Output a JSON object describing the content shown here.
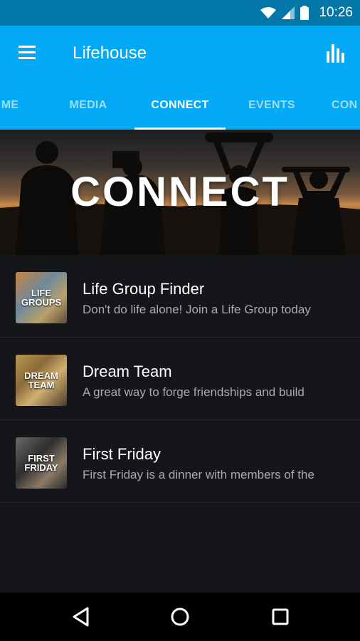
{
  "status_bar": {
    "time": "10:26",
    "icons": [
      "wifi-icon",
      "signal-icon",
      "battery-icon"
    ]
  },
  "toolbar": {
    "title": "Lifehouse",
    "menu_icon": "hamburger-menu-icon",
    "action_icon": "bar-chart-icon"
  },
  "tabs": [
    {
      "label": "HOME",
      "visible_text": "ME",
      "active": false
    },
    {
      "label": "MEDIA",
      "active": false
    },
    {
      "label": "CONNECT",
      "active": true
    },
    {
      "label": "EVENTS",
      "active": false
    },
    {
      "label": "CONNECT",
      "visible_text": "CON",
      "active": false
    }
  ],
  "hero": {
    "title": "CONNECT"
  },
  "list": [
    {
      "title": "Life Group Finder",
      "subtitle": "Don't do life alone! Join a Life Group today",
      "thumb_text": "LIFE GROUPS"
    },
    {
      "title": "Dream Team",
      "subtitle": "A great way to forge friendships and build",
      "thumb_text": "DREAM TEAM"
    },
    {
      "title": "First Friday",
      "subtitle": "First Friday is a dinner with members of the",
      "thumb_text": "FIRST FRIDAY"
    }
  ],
  "nav_bar": {
    "icons": [
      "back-icon",
      "home-icon",
      "recents-icon"
    ]
  },
  "colors": {
    "status_bar": "#0277a8",
    "primary": "#03a9f4",
    "background": "#151619",
    "tab_inactive": "#9fdcf7",
    "subtitle": "#a9abad"
  }
}
